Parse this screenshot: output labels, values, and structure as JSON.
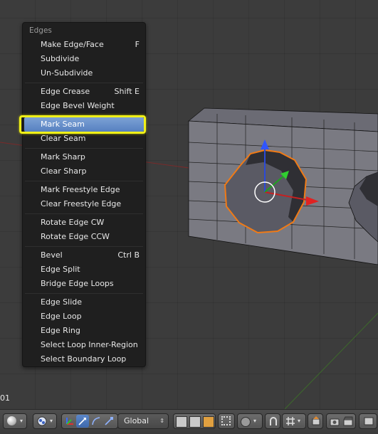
{
  "menu": {
    "title": "Edges",
    "items": [
      {
        "label": "Make Edge/Face",
        "shortcut": "F"
      },
      {
        "label": "Subdivide",
        "shortcut": ""
      },
      {
        "label": "Un-Subdivide",
        "shortcut": ""
      },
      {
        "label": "Edge Crease",
        "shortcut": "Shift E"
      },
      {
        "label": "Edge Bevel Weight",
        "shortcut": ""
      },
      {
        "label": "Mark Seam",
        "shortcut": ""
      },
      {
        "label": "Clear Seam",
        "shortcut": ""
      },
      {
        "label": "Mark Sharp",
        "shortcut": ""
      },
      {
        "label": "Clear Sharp",
        "shortcut": ""
      },
      {
        "label": "Mark Freestyle Edge",
        "shortcut": ""
      },
      {
        "label": "Clear Freestyle Edge",
        "shortcut": ""
      },
      {
        "label": "Rotate Edge CW",
        "shortcut": ""
      },
      {
        "label": "Rotate Edge CCW",
        "shortcut": ""
      },
      {
        "label": "Bevel",
        "shortcut": "Ctrl B"
      },
      {
        "label": "Edge Split",
        "shortcut": ""
      },
      {
        "label": "Bridge Edge Loops",
        "shortcut": ""
      },
      {
        "label": "Edge Slide",
        "shortcut": ""
      },
      {
        "label": "Edge Loop",
        "shortcut": ""
      },
      {
        "label": "Edge Ring",
        "shortcut": ""
      },
      {
        "label": "Select Loop Inner-Region",
        "shortcut": ""
      },
      {
        "label": "Select Boundary Loop",
        "shortcut": ""
      }
    ],
    "selected": "Mark Seam"
  },
  "viewport": {
    "frame_counter": "01"
  },
  "toolbar": {
    "orientation": "Global",
    "icons": [
      "viewport-shading-icon",
      "pivot-point-icon",
      "manipulator-icon",
      "translate-icon",
      "rotate-icon",
      "scale-icon",
      "vertex-select-icon",
      "edge-select-icon",
      "face-select-icon",
      "occlude-geometry-icon",
      "proportional-editing-icon",
      "snap-icon",
      "snap-target-icon",
      "render-icon",
      "render-animation-icon"
    ]
  },
  "colors": {
    "selection": "#f07a16",
    "highlight": "#f0f018",
    "menu_selected": "#6e95d0"
  }
}
